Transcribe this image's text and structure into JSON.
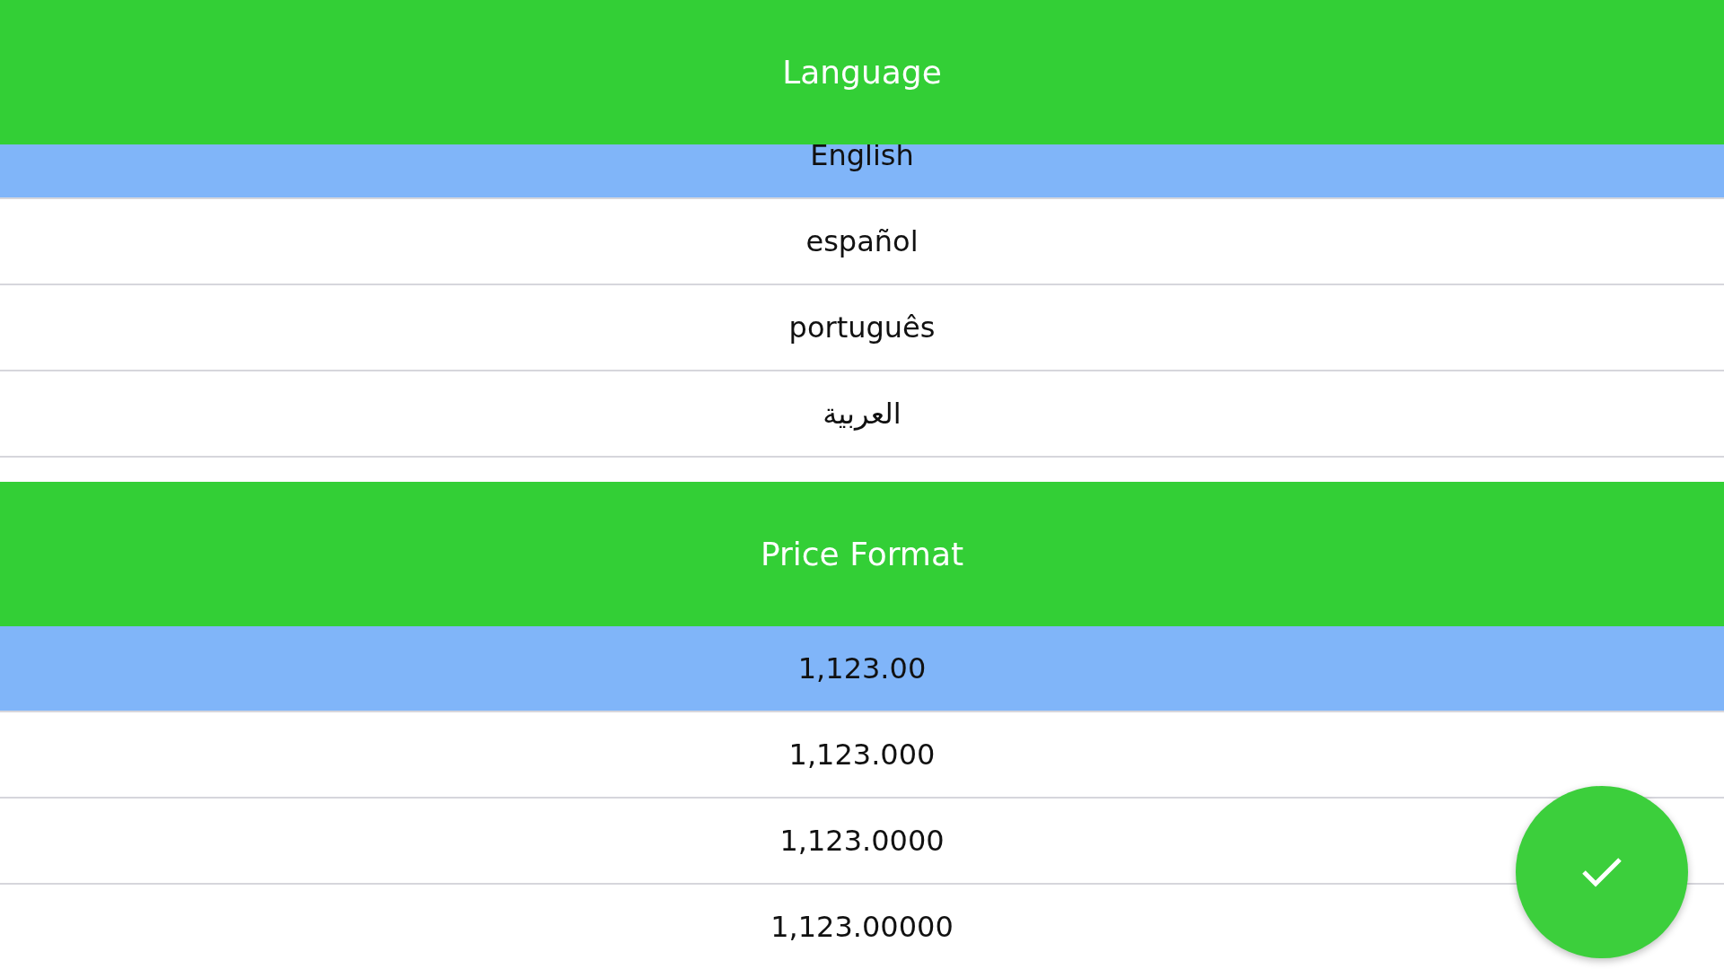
{
  "sections": [
    {
      "title": "Language",
      "options": [
        {
          "label": "English",
          "selected": true
        },
        {
          "label": "español",
          "selected": false
        },
        {
          "label": "português",
          "selected": false
        },
        {
          "label": "العربية",
          "selected": false
        }
      ]
    },
    {
      "title": "Price Format",
      "options": [
        {
          "label": "1,123.00",
          "selected": true
        },
        {
          "label": "1,123.000",
          "selected": false
        },
        {
          "label": "1,123.0000",
          "selected": false
        },
        {
          "label": "1,123.00000",
          "selected": false
        }
      ]
    }
  ]
}
